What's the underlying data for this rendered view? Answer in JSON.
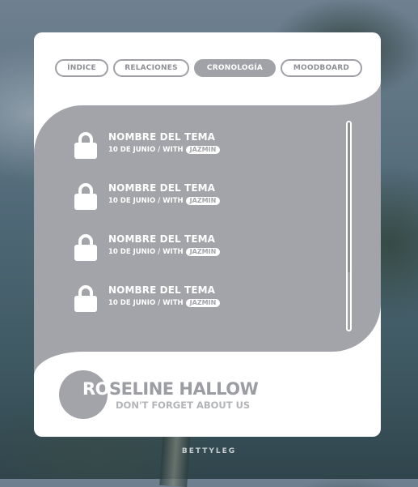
{
  "nav": {
    "tabs": [
      {
        "label": "ÍNDICE",
        "active": false
      },
      {
        "label": "RELACIONES",
        "active": false
      },
      {
        "label": "CRONOLOGÍA",
        "active": true
      },
      {
        "label": "MOODBOARD",
        "active": false
      }
    ]
  },
  "entries": [
    {
      "title": "NOMBRE DEL TEMA",
      "date": "10 DE JUNIO / WITH",
      "tag": "JAZMIN",
      "icon": "lock-icon"
    },
    {
      "title": "NOMBRE DEL TEMA",
      "date": "10 DE JUNIO / WITH",
      "tag": "JAZMIN",
      "icon": "lock-icon"
    },
    {
      "title": "NOMBRE DEL TEMA",
      "date": "10 DE JUNIO / WITH",
      "tag": "JAZMIN",
      "icon": "lock-icon"
    },
    {
      "title": "NOMBRE DEL TEMA",
      "date": "10 DE JUNIO / WITH",
      "tag": "JAZMIN",
      "icon": "lock-icon"
    }
  ],
  "profile": {
    "name_highlight": "RO",
    "name_rest": "SELINE HALLOW",
    "tagline": "DON'T FORGET ABOUT US"
  },
  "credit": "BETTYLEG",
  "colors": {
    "panel": "#a3a4a9",
    "card": "#ffffff",
    "tab_border": "#9ea0a5"
  }
}
